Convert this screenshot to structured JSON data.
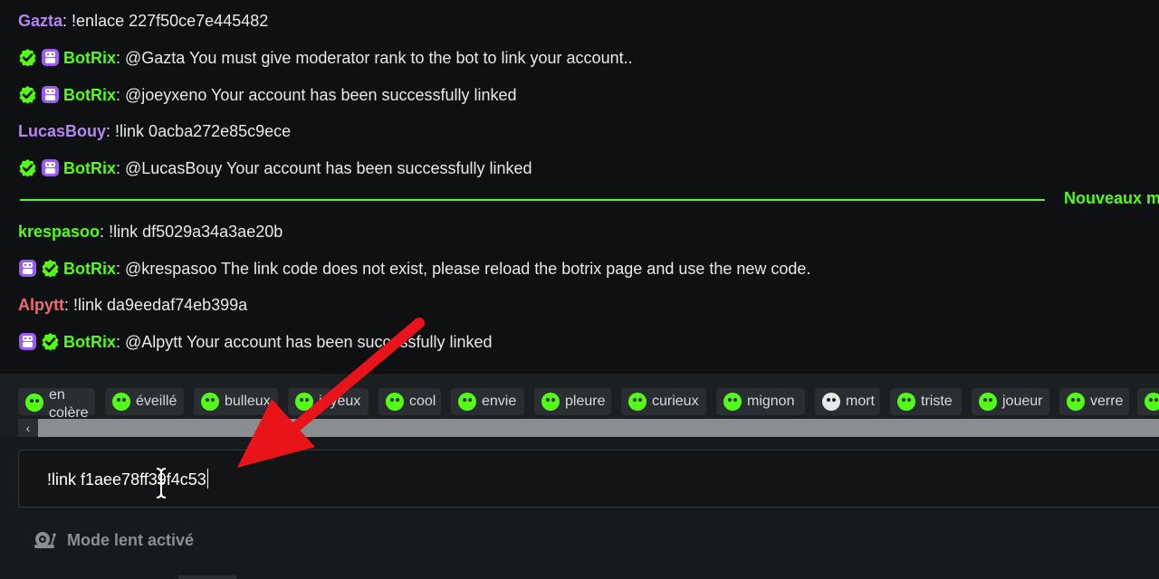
{
  "chat": {
    "messages": [
      {
        "user": "Gazta",
        "color": "#b884f5",
        "sep": ": ",
        "text": "!enlace 227f50ce7e445482",
        "badges": []
      },
      {
        "user": "BotRix",
        "color": "#53fc18",
        "sep": ": ",
        "text": "@Gazta You must give moderator rank to the bot to link your account..",
        "badges": [
          "verified-icon",
          "bot-icon"
        ]
      },
      {
        "user": "BotRix",
        "color": "#53fc18",
        "sep": ": ",
        "text": "@joeyxeno Your account has been successfully linked",
        "badges": [
          "verified-icon",
          "bot-icon"
        ]
      },
      {
        "user": "LucasBouy",
        "color": "#b884f5",
        "sep": ": ",
        "text": "!link 0acba272e85c9ece",
        "badges": []
      },
      {
        "user": "BotRix",
        "color": "#53fc18",
        "sep": ": ",
        "text": "@LucasBouy Your account has been successfully linked",
        "badges": [
          "verified-icon",
          "bot-icon"
        ]
      },
      {
        "user": "krespasoo",
        "color": "#53fc18",
        "sep": ": ",
        "text": "!link df5029a34a3ae20b",
        "badges": []
      },
      {
        "user": "BotRix",
        "color": "#53fc18",
        "sep": ": ",
        "text": "@krespasoo The link code does not exist, please reload the botrix page and use the new code.",
        "badges": [
          "bot-icon",
          "verified-icon"
        ]
      },
      {
        "user": "Alpytt",
        "color": "#f06a78",
        "sep": ": ",
        "text": "!link da9eedaf74eb399a",
        "badges": []
      },
      {
        "user": "BotRix",
        "color": "#53fc18",
        "sep": ": ",
        "text": "@Alpytt Your account has been successfully linked",
        "badges": [
          "bot-icon",
          "verified-icon"
        ]
      }
    ],
    "divider_label": "Nouveaux m"
  },
  "emotes": [
    {
      "label": "en\ncolère",
      "icon": "angry-emote-icon"
    },
    {
      "label": "éveillé",
      "icon": "awake-emote-icon"
    },
    {
      "label": "bulleux",
      "icon": "bubbly-emote-icon"
    },
    {
      "label": "joyeux",
      "icon": "happy-emote-icon"
    },
    {
      "label": "cool",
      "icon": "cool-emote-icon"
    },
    {
      "label": "envie",
      "icon": "envy-emote-icon"
    },
    {
      "label": "pleure",
      "icon": "crying-emote-icon"
    },
    {
      "label": "curieux",
      "icon": "curious-emote-icon"
    },
    {
      "label": "mignon",
      "icon": "cute-emote-icon"
    },
    {
      "label": "mort",
      "icon": "dead-emote-icon"
    },
    {
      "label": "triste",
      "icon": "sad-emote-icon"
    },
    {
      "label": "joueur",
      "icon": "gamer-emote-icon"
    },
    {
      "label": "verre",
      "icon": "glass-emote-icon"
    }
  ],
  "input": {
    "value": "!link f1aee78ff39f4c53"
  },
  "slow_mode": {
    "label": "Mode lent activé",
    "icon": "snail-icon"
  },
  "colors": {
    "accent": "#53fc18",
    "arrow": "#e8141a"
  }
}
